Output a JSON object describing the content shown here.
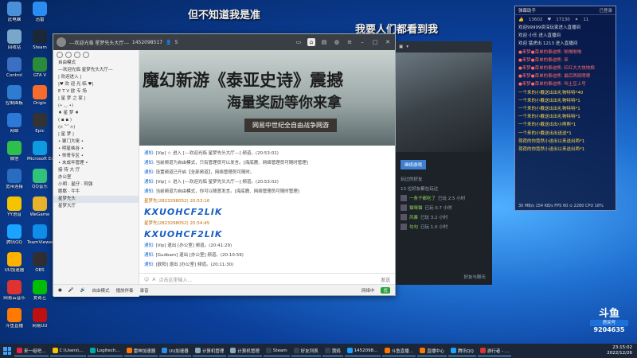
{
  "desktop_icons": [
    {
      "label": "此电脑",
      "color": "#4a90d9"
    },
    {
      "label": "回收站",
      "color": "#7aa6c9"
    },
    {
      "label": "Control",
      "color": "#3b6fc2"
    },
    {
      "label": "控制面板",
      "color": "#2f7bd0"
    },
    {
      "label": "网络",
      "color": "#2c7ad6"
    },
    {
      "label": "微信",
      "color": "#2ec04a"
    },
    {
      "label": "宽带连接",
      "color": "#2a6cc0"
    },
    {
      "label": "YY语音",
      "color": "#f5c400"
    },
    {
      "label": "腾讯QQ",
      "color": "#1aa3ff"
    },
    {
      "label": "UU加速器",
      "color": "#ffb200"
    },
    {
      "label": "网易云音乐",
      "color": "#d33"
    },
    {
      "label": "斗鱼直播",
      "color": "#ff7a00"
    },
    {
      "label": "迅雷",
      "color": "#2c8df0"
    },
    {
      "label": "Steam",
      "color": "#1b2838"
    },
    {
      "label": "GTA V",
      "color": "#2a8c3a"
    },
    {
      "label": "Origin",
      "color": "#f56c2d"
    },
    {
      "label": "Epic",
      "color": "#333"
    },
    {
      "label": "Microsoft Edge",
      "color": "#0f9be0"
    },
    {
      "label": "QQ音乐",
      "color": "#31c27c"
    },
    {
      "label": "WeGame",
      "color": "#e8b32a"
    },
    {
      "label": "TeamViewer",
      "color": "#0e8ee9"
    },
    {
      "label": "OBS",
      "color": "#302e31"
    },
    {
      "label": "爱奇艺",
      "color": "#00be06"
    },
    {
      "label": "网易UU",
      "color": "#b11"
    }
  ],
  "overlay": {
    "top": "但不知道我是准",
    "mid": "我要人们都看到我"
  },
  "chat_window": {
    "title": "---欢迎光临 星梦先头大厅---",
    "room_id": "1452098517",
    "count": "5",
    "sidebar_rows": [
      "自由模式",
      "---欢迎光临 星梦先头大厅---",
      "| 欢迎进入 |",
      "|♥ 欢 迎 光 临 ♥|",
      "E T V 欧 专 场",
      "| 星 梦 之 家 |",
      "(• ◡ •)",
      "♦ 星 梦 ♦",
      "( ▪ ▪ )",
      "(∩ ︶ ∩)",
      "| 星 梦 |",
      "• 聚门大佬 •",
      "• 明星峡谷 •",
      "• 帅哥专区 •",
      "• 未成年管理 •",
      "接 待 大 厅",
      "办公室",
      "小明 · 星仔 · 阿强",
      "憨憨 · 牛牛",
      "星梦先头",
      "星梦大厅"
    ],
    "banner": {
      "line1": "魔幻新游《泰亚史诗》震撼",
      "line2": "海量奖励等你来拿",
      "line3": "网易中世纪全自由战争网游"
    },
    "messages": [
      {
        "tag": "通知:",
        "text": "[Vip] ☆ 进入 [---欢迎光临 星梦先头大厅---] 频道。(20:53:01)",
        "kind": "line"
      },
      {
        "tag": "通知:",
        "text": "当前频道为自由模式，只有管理员可以发言。[海底鹿、网络管理员可随时管理]",
        "kind": "line"
      },
      {
        "tag": "通知:",
        "text": "设置频道已开启【全部频道】，网络管理员可随时。",
        "kind": "line"
      },
      {
        "tag": "通知:",
        "text": "[Vip] ☆ 进入 [---欢迎光临 星梦先头大厅---] 频道。(20:53:02)",
        "kind": "line"
      },
      {
        "tag": "通知:",
        "text": "当前频道为自由模式，你可以随意发言。[海底鹿、网络管理员可随时管理]",
        "kind": "line"
      },
      {
        "tag": "",
        "text": "星梦先(2823298052) 20:53:16",
        "kind": "user"
      },
      {
        "tag": "",
        "text": "KXUOHCF2LIK",
        "kind": "big"
      },
      {
        "tag": "",
        "text": "星梦先(2823298052) 20:54:45",
        "kind": "user"
      },
      {
        "tag": "",
        "text": "KXUOHCF2LIK",
        "kind": "big"
      },
      {
        "tag": "通知:",
        "text": "[Vip] 退出 [办公室] 频道。(20:41:29)",
        "kind": "line"
      },
      {
        "tag": "通知:",
        "text": "[Gudbam] 退出 [办公室] 频道。(20:10:59)",
        "kind": "line"
      },
      {
        "tag": "通知:",
        "text": "[欧阳] 退出 [办公室] 频道。(20:11:30)",
        "kind": "line"
      }
    ],
    "input_placeholder": "点击这里输入...",
    "send_label": "发送",
    "bottom_items": [
      "自由模式",
      "播放伴奏",
      "录音"
    ],
    "quality": "网络中",
    "good": "优"
  },
  "game_panel": {
    "button": "继续游戏",
    "section": "玩过的好友",
    "friends_count": "13 位好友都在玩过",
    "friends": [
      {
        "name": "一条子都吃了",
        "time": "已玩 2.5 小时"
      },
      {
        "name": "猫咪猫",
        "time": "已玩 0.7 小时"
      },
      {
        "name": "风暴",
        "time": "已玩 3.2 小时"
      },
      {
        "name": "勾勾",
        "time": "已玩 1.0 小时"
      }
    ],
    "friends_label": "好友与聊天"
  },
  "danmaku": {
    "title": "弹幕助手",
    "status": "已登录",
    "stats": [
      "13602",
      "17130",
      "11"
    ],
    "lines": [
      {
        "user": "",
        "text": "欢迎99999资深玩家进入直播间",
        "color": "white"
      },
      {
        "user": "",
        "text": "欢迎 小乐 进入直播间",
        "color": "white"
      },
      {
        "user": "",
        "text": "欢迎 猛虎出 1213 进入直播间",
        "color": "white"
      },
      {
        "user": "一个来的",
        "text": "●来梦●菜单的泰迪熊: 啪啪啪啪",
        "color": "red"
      },
      {
        "user": "",
        "text": "●来梦●菜单的泰迪熊: 来",
        "color": "red"
      },
      {
        "user": "",
        "text": "●来梦●菜单的泰迪熊: 红红大大快快棉",
        "color": "red"
      },
      {
        "user": "",
        "text": "●来梦●菜单的泰迪熊: 最后两局嗯嗯",
        "color": "red"
      },
      {
        "user": "",
        "text": "●来梦●菜单的泰迪熊: 叫土豆上号",
        "color": "red"
      },
      {
        "user": "",
        "text": "一个来的小戴送出出礼物特特*40",
        "color": "yellow"
      },
      {
        "user": "",
        "text": "一个来的小戴送出出礼物特特*1",
        "color": "yellow"
      },
      {
        "user": "",
        "text": "一个来的小戴送出出礼物特特*1",
        "color": "yellow"
      },
      {
        "user": "",
        "text": "一个来的小戴送出出礼物特特*1",
        "color": "yellow"
      },
      {
        "user": "",
        "text": "一个来的小戴送出出小熊熊*1",
        "color": "yellow"
      },
      {
        "user": "",
        "text": "一个来的小戴送出出送送*1",
        "color": "yellow"
      },
      {
        "user": "",
        "text": "荷荷的你竟然小送出以来送出两*1",
        "color": "yellow"
      },
      {
        "user": "",
        "text": "荷荷的你竟然小送出以来送出两*1",
        "color": "yellow"
      }
    ],
    "footer": "30 MB/s 154 KB/s  FPS 60  ⊙ 2280 CPU 18%  RAM 40%"
  },
  "douyu": {
    "logo": "斗鱼",
    "room_label": "房间号",
    "room_id": "9204635"
  },
  "taskbar": {
    "items": [
      {
        "label": "来一组吧…",
        "color": "#e24"
      },
      {
        "label": "C:\\Users\\…",
        "color": "#f5c400"
      },
      {
        "label": "Logitech…",
        "color": "#0aa"
      },
      {
        "label": "雷神加速器",
        "color": "#f70"
      },
      {
        "label": "UU加速器",
        "color": "#2c8df0"
      },
      {
        "label": "计算机管理",
        "color": "#8ab"
      },
      {
        "label": "计算机管理",
        "color": "#8ab"
      },
      {
        "label": "Steam",
        "color": "#345"
      },
      {
        "label": "好友列表",
        "color": "#345"
      },
      {
        "label": "蒲鸦",
        "color": "#345"
      },
      {
        "label": "1452098…",
        "color": "#1aa3ff"
      },
      {
        "label": "斗鱼直播…",
        "color": "#f70"
      },
      {
        "label": "直播中心",
        "color": "#f70"
      },
      {
        "label": "腾讯QQ",
        "color": "#1aa3ff"
      },
      {
        "label": "游行者 - …",
        "color": "#d33"
      }
    ],
    "time": "23:15:02",
    "date": "2022/12/26"
  }
}
